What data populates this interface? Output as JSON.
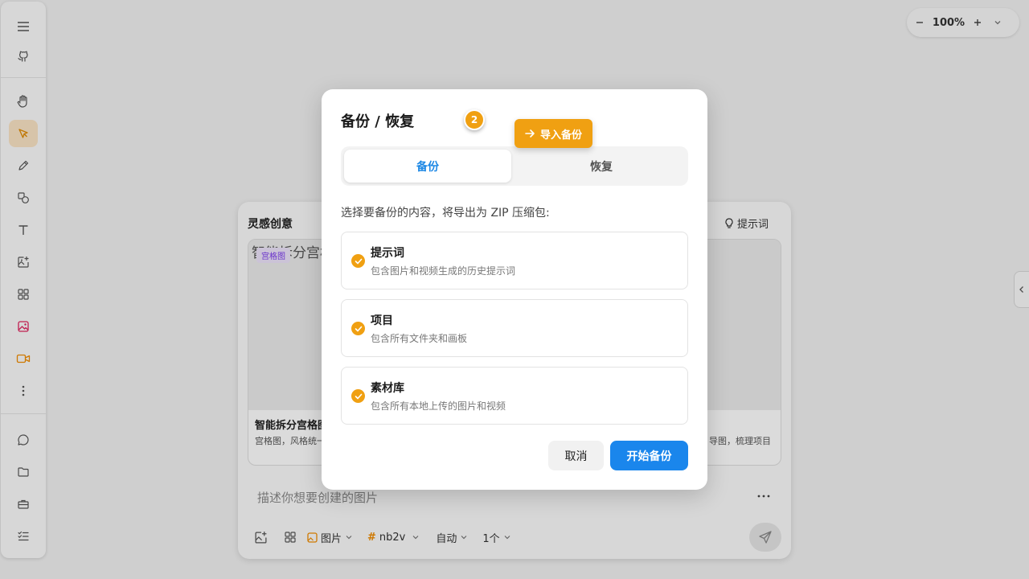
{
  "zoom": {
    "value": "100%"
  },
  "panel": {
    "title": "灵感创意",
    "tip_label": "提示词",
    "cards": [
      {
        "image_alt": "智能拆分宫格图",
        "badge": "宫格图",
        "title": "智能拆分宫格图",
        "desc": "宫格图，风格统一"
      },
      {
        "desc": "导图，梳理项目"
      }
    ],
    "prompt_placeholder": "描述你想要创建的图片",
    "options": {
      "type": "图片",
      "model": "nb2v",
      "ratio": "自动",
      "count": "1个"
    }
  },
  "modal": {
    "title": "备份 / 恢复",
    "tabs": [
      "备份",
      "恢复"
    ],
    "description": "选择要备份的内容，将导出为 ZIP 压缩包:",
    "items": [
      {
        "title": "提示词",
        "desc": "包含图片和视频生成的历史提示词",
        "checked": true
      },
      {
        "title": "项目",
        "desc": "包含所有文件夹和画板",
        "checked": true
      },
      {
        "title": "素材库",
        "desc": "包含所有本地上传的图片和视频",
        "checked": true
      }
    ],
    "cancel_label": "取消",
    "start_label": "开始备份"
  },
  "tour": {
    "step": "2",
    "button_label": "导入备份"
  },
  "colors": {
    "accent": "#f0a012",
    "primary": "#1a86ec",
    "tab_active_text": "#1d88e5"
  }
}
